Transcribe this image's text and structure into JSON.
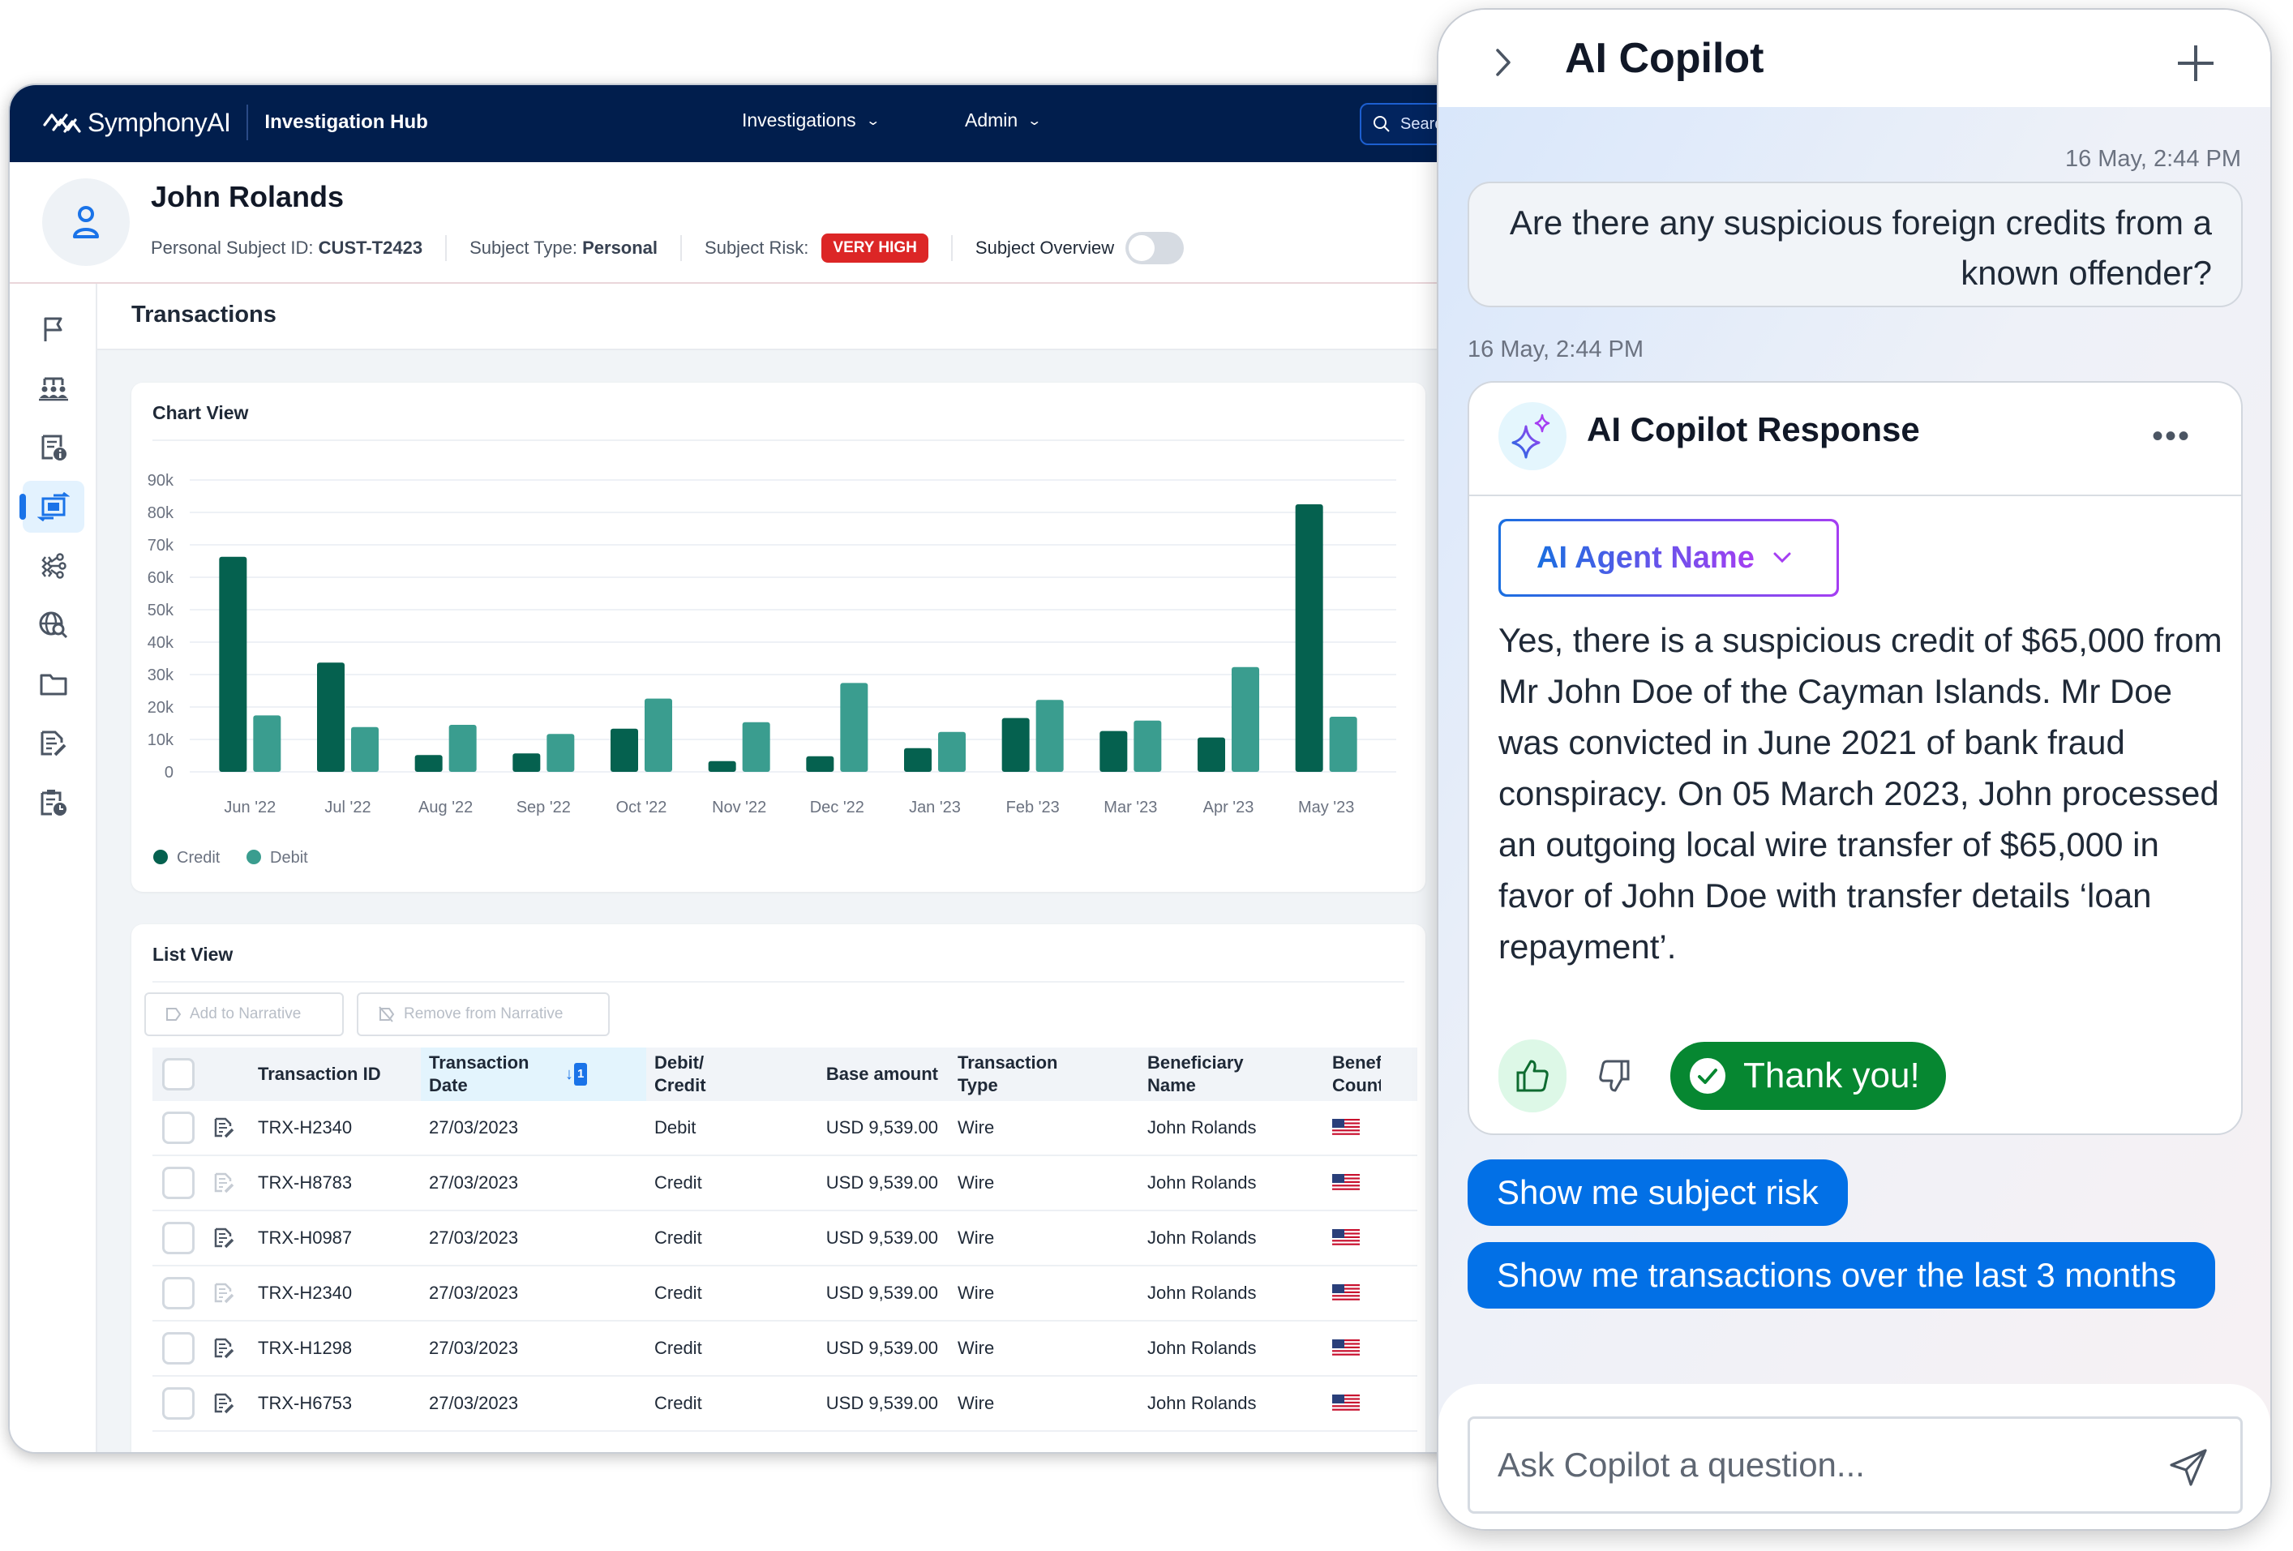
{
  "app": {
    "brand": "SymphonyAI",
    "product": "Investigation Hub",
    "nav": [
      {
        "label": "Investigations",
        "icon": "chevron-down-icon"
      },
      {
        "label": "Admin",
        "icon": "chevron-down-icon"
      }
    ],
    "search_placeholder": "Search"
  },
  "subject": {
    "name": "John Rolands",
    "id_label": "Personal Subject ID:",
    "id_value": "CUST-T2423",
    "type_label": "Subject Type:",
    "type_value": "Personal",
    "risk_label": "Subject Risk:",
    "risk_value": "VERY HIGH",
    "overview_label": "Subject Overview",
    "overview_on": false
  },
  "sidebar": {
    "items": [
      {
        "icon": "flag-icon",
        "active": false
      },
      {
        "icon": "network-people-icon",
        "active": false
      },
      {
        "icon": "document-info-icon",
        "active": false
      },
      {
        "icon": "transactions-icon",
        "active": true
      },
      {
        "icon": "connections-icon",
        "active": false
      },
      {
        "icon": "globe-search-icon",
        "active": false
      },
      {
        "icon": "folder-icon",
        "active": false
      },
      {
        "icon": "narrative-edit-icon",
        "active": false
      },
      {
        "icon": "clipboard-clock-icon",
        "active": false
      }
    ]
  },
  "page": {
    "title": "Transactions"
  },
  "chart_card": {
    "title": "Chart View"
  },
  "chart_data": {
    "type": "bar",
    "title": "Chart View",
    "xlabel": "",
    "ylabel": "",
    "ylim": [
      0,
      90000
    ],
    "yticks": [
      "0",
      "10k",
      "20k",
      "30k",
      "40k",
      "50k",
      "60k",
      "70k",
      "80k",
      "90k"
    ],
    "ytick_values": [
      0,
      10000,
      20000,
      30000,
      40000,
      50000,
      60000,
      70000,
      80000,
      90000
    ],
    "grid": true,
    "legend": "bottom-left",
    "categories": [
      "Jun '22",
      "Jul '22",
      "Aug '22",
      "Sep '22",
      "Oct '22",
      "Nov '22",
      "Dec '22",
      "Jan '23",
      "Feb '23",
      "Mar '23",
      "Apr '23",
      "May '23"
    ],
    "series": [
      {
        "name": "Credit",
        "color": "#05614f",
        "values": [
          66300,
          33700,
          5200,
          5700,
          13300,
          3300,
          4800,
          7300,
          16600,
          12600,
          10600,
          82500
        ]
      },
      {
        "name": "Debit",
        "color": "#3a9d8f",
        "values": [
          17400,
          13800,
          14500,
          11700,
          22600,
          15300,
          27400,
          12300,
          22200,
          15800,
          32300,
          17000
        ]
      }
    ]
  },
  "list_card": {
    "title": "List View",
    "add_button": "Add to Narrative",
    "remove_button": "Remove from Narrative",
    "columns": [
      {
        "key": "id",
        "label": "Transaction ID"
      },
      {
        "key": "date",
        "label": "Transaction Date",
        "sorted": true,
        "sort_order": "1"
      },
      {
        "key": "dc",
        "label": "Debit/ Credit"
      },
      {
        "key": "amount",
        "label": "Base amount"
      },
      {
        "key": "type",
        "label": "Transaction Type"
      },
      {
        "key": "beneficiary",
        "label": "Beneficiary Name"
      },
      {
        "key": "country",
        "label": "Beneficiary Country"
      }
    ],
    "rows": [
      {
        "id": "TRX-H2340",
        "date": "27/03/2023",
        "dc": "Debit",
        "amount": "USD 9,539.00",
        "type": "Wire",
        "beneficiary": "John Rolands",
        "country": "US",
        "narrative_enabled": true
      },
      {
        "id": "TRX-H8783",
        "date": "27/03/2023",
        "dc": "Credit",
        "amount": "USD 9,539.00",
        "type": "Wire",
        "beneficiary": "John Rolands",
        "country": "US",
        "narrative_enabled": false
      },
      {
        "id": "TRX-H0987",
        "date": "27/03/2023",
        "dc": "Credit",
        "amount": "USD 9,539.00",
        "type": "Wire",
        "beneficiary": "John Rolands",
        "country": "US",
        "narrative_enabled": true
      },
      {
        "id": "TRX-H2340",
        "date": "27/03/2023",
        "dc": "Credit",
        "amount": "USD 9,539.00",
        "type": "Wire",
        "beneficiary": "John Rolands",
        "country": "US",
        "narrative_enabled": false
      },
      {
        "id": "TRX-H1298",
        "date": "27/03/2023",
        "dc": "Credit",
        "amount": "USD 9,539.00",
        "type": "Wire",
        "beneficiary": "John Rolands",
        "country": "US",
        "narrative_enabled": true
      },
      {
        "id": "TRX-H6753",
        "date": "27/03/2023",
        "dc": "Credit",
        "amount": "USD 9,539.00",
        "type": "Wire",
        "beneficiary": "John Rolands",
        "country": "US",
        "narrative_enabled": true
      }
    ]
  },
  "copilot": {
    "title": "AI Copilot",
    "user_timestamp": "16 May, 2:44 PM",
    "user_message": "Are there any suspicious foreign credits from a known offender?",
    "response_timestamp": "16 May, 2:44 PM",
    "response_title": "AI Copilot Response",
    "more_label": "•••",
    "agent_name": "AI Agent Name",
    "response_text": "Yes, there is a suspicious credit of $65,000 from Mr John Doe of the Cayman Islands. Mr Doe was convicted in June 2021 of bank fraud conspiracy. On 05 March 2023, John processed an outgoing local wire transfer of $65,000 in favor of John Doe with transfer details ‘loan repayment’.",
    "feedback_thanks": "Thank you!",
    "suggestions": [
      "Show me subject risk",
      "Show me transactions over the last 3 months"
    ],
    "input_placeholder": "Ask Copilot a question..."
  },
  "colors": {
    "navbar": "#011e4d",
    "accent": "#1a73e8",
    "risk": "#dc2626",
    "credit": "#05614f",
    "debit": "#3a9d8f",
    "suggestion": "#0270e6",
    "thanks": "#068731"
  }
}
